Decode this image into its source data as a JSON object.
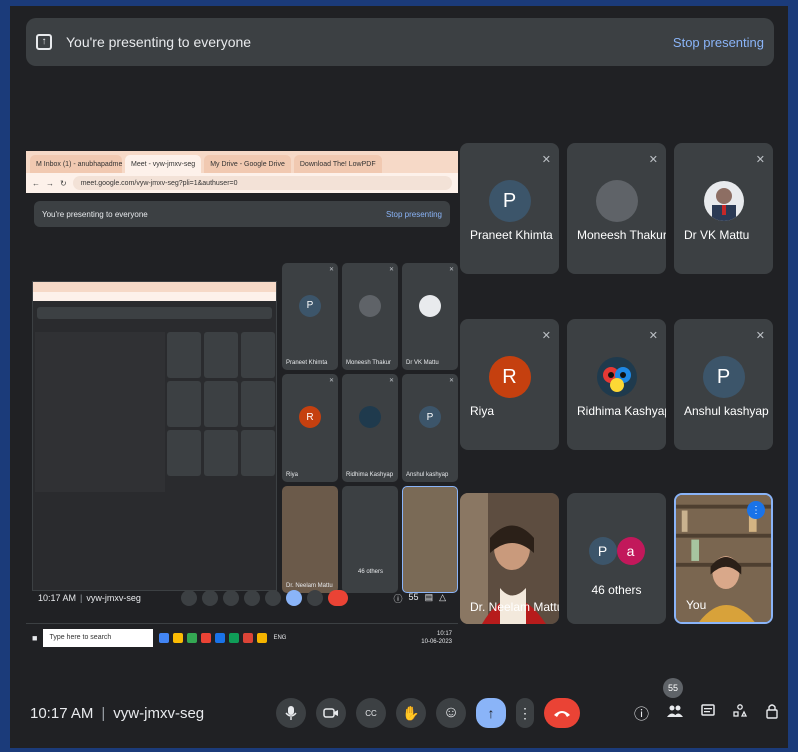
{
  "banner": {
    "message": "You're presenting to everyone",
    "stop_label": "Stop presenting"
  },
  "shared_screen": {
    "tabs": [
      "M Inbox (1) - anubhapadmesh@gm",
      "Meet - vyw-jmxv-seg",
      "My Drive - Google Drive",
      "Download The! LowPDF"
    ],
    "url": "meet.google.com/vyw-jmxv-seg?pli=1&authuser=0",
    "banner_message": "You're presenting to everyone",
    "banner_stop": "Stop presenting",
    "tiles": [
      {
        "name": "Praneet Khimta",
        "initial": "P",
        "color": "#5f6368"
      },
      {
        "name": "Moneesh Thakur",
        "initial": "",
        "color": "#5f6368"
      },
      {
        "name": "Dr VK Mattu",
        "initial": "",
        "color": "#3c4043"
      },
      {
        "name": "Riya",
        "initial": "R",
        "color": "#c5400f"
      },
      {
        "name": "Ridhima Kashyap",
        "initial": "",
        "color": "#3c4043"
      },
      {
        "name": "Anshul kashyap",
        "initial": "P",
        "color": "#5f6368"
      },
      {
        "name": "Dr. Neelam Mattu",
        "initial": "",
        "color": "#3c4043"
      },
      {
        "name": "46 others",
        "initial": "",
        "color": "#3c4043"
      },
      {
        "name": "",
        "initial": "",
        "color": "#3c4043"
      }
    ],
    "time": "10:17 AM",
    "meeting_code": "vyw-jmxv-seg",
    "participant_count": "55",
    "taskbar_search": "Type here to search",
    "taskbar_time": "10:17",
    "taskbar_date": "10-06-2023",
    "taskbar_lang": "ENG"
  },
  "participants": [
    {
      "name": "Praneet Khimta",
      "initial": "P",
      "avatar_color": "#3c556a",
      "muted": true
    },
    {
      "name": "Moneesh Thakur",
      "initial": "",
      "avatar_color": "#5f6368",
      "muted": true
    },
    {
      "name": "Dr VK Mattu",
      "initial": "",
      "avatar_color": "#e8eaed",
      "muted": true
    },
    {
      "name": "Riya",
      "initial": "R",
      "avatar_color": "#c5400f",
      "muted": true
    },
    {
      "name": "Ridhima Kashyap",
      "initial": "",
      "avatar_color": "#3c4043",
      "muted": true
    },
    {
      "name": "Anshul kashyap",
      "initial": "P",
      "avatar_color": "#3c556a",
      "muted": true
    },
    {
      "name": "Dr. Neelam Mattu",
      "initial": "",
      "avatar_color": "#3c4043",
      "muted": false
    },
    {
      "name": "46 others",
      "initial": "",
      "avatar_color": "#3c4043",
      "muted": false
    },
    {
      "name": "You",
      "initial": "",
      "avatar_color": "#3c4043",
      "muted": false
    }
  ],
  "others_avatars": [
    {
      "initial": "P",
      "color": "#3c556a"
    },
    {
      "initial": "a",
      "color": "#c2185b"
    }
  ],
  "bottom": {
    "time": "10:17 AM",
    "separator": "|",
    "meeting_code": "vyw-jmxv-seg",
    "people_count": "55"
  },
  "icons": {
    "present": "↑",
    "mic": "🎤",
    "camera": "▢",
    "captions": "CC",
    "hand": "✋",
    "emoji": "☺",
    "more": "⋮",
    "leave": "⌒",
    "info": "ⓘ",
    "people": "👥",
    "chat": "▤",
    "activities": "△",
    "lock": "🔒",
    "mic_off": "✕"
  }
}
